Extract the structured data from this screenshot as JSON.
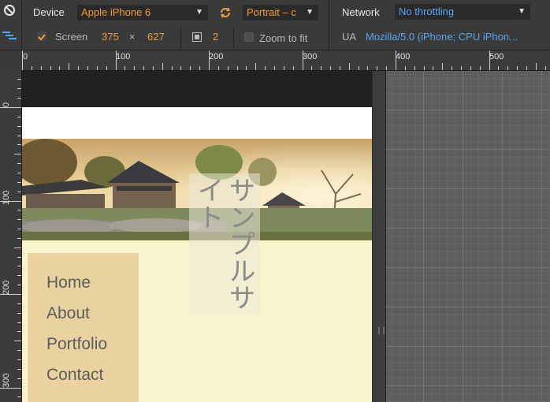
{
  "toolbar": {
    "device_label": "Device",
    "device_value": "Apple iPhone 6",
    "orientation_value": "Portrait – c",
    "network_label": "Network",
    "network_value": "No throttling",
    "screen_label": "Screen",
    "screen_width": "375",
    "screen_times": "×",
    "screen_height": "627",
    "dpr_value": "2",
    "zoom_label": "Zoom to fit",
    "ua_label": "UA",
    "ua_value": "Mozilla/5.0 (iPhone; CPU iPhon..."
  },
  "ruler": {
    "h_labels": [
      "0",
      "100",
      "200",
      "300",
      "400",
      "500"
    ],
    "v_labels": [
      "0",
      "100",
      "200",
      "300"
    ]
  },
  "page": {
    "site_title": "サンプルサイト",
    "nav": [
      "Home",
      "About",
      "Portfolio",
      "Contact"
    ]
  },
  "colors": {
    "accent_orange": "#f29d38",
    "accent_blue": "#58a6f2",
    "page_background": "#f8f5cc",
    "nav_background": "#e9d29f"
  }
}
